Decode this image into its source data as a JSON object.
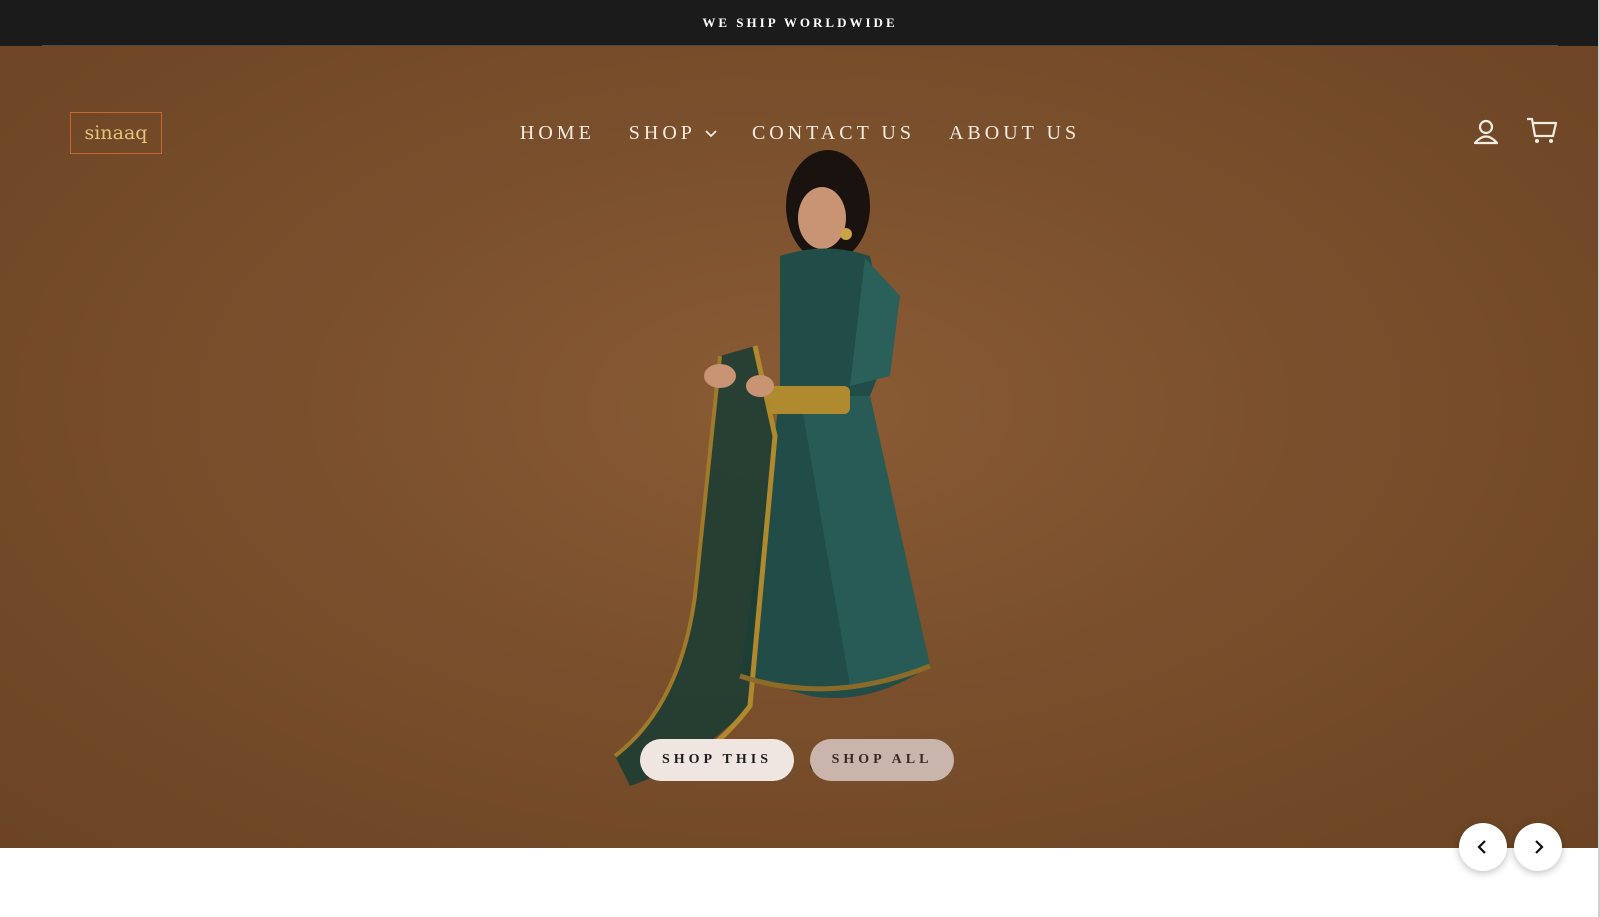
{
  "announcement": {
    "text": "WE SHIP WORLDWIDE"
  },
  "header": {
    "logo_text": "sinaaq",
    "nav": [
      {
        "label": "HOME"
      },
      {
        "label": "SHOP",
        "has_dropdown": true
      },
      {
        "label": "CONTACT US"
      },
      {
        "label": "ABOUT US"
      }
    ],
    "icons": [
      "account-icon",
      "cart-icon"
    ]
  },
  "hero": {
    "buttons": {
      "shop_this": "SHOP THIS",
      "shop_all": "SHOP ALL"
    },
    "slider_controls": [
      "prev-arrow-icon",
      "next-arrow-icon"
    ]
  },
  "colors": {
    "announcement_bg": "#1b1b1b",
    "hero_bg": "#7a4f2c",
    "logo_border": "#c9652e",
    "logo_text": "#e6c27a",
    "dress": "#1f4a45"
  }
}
